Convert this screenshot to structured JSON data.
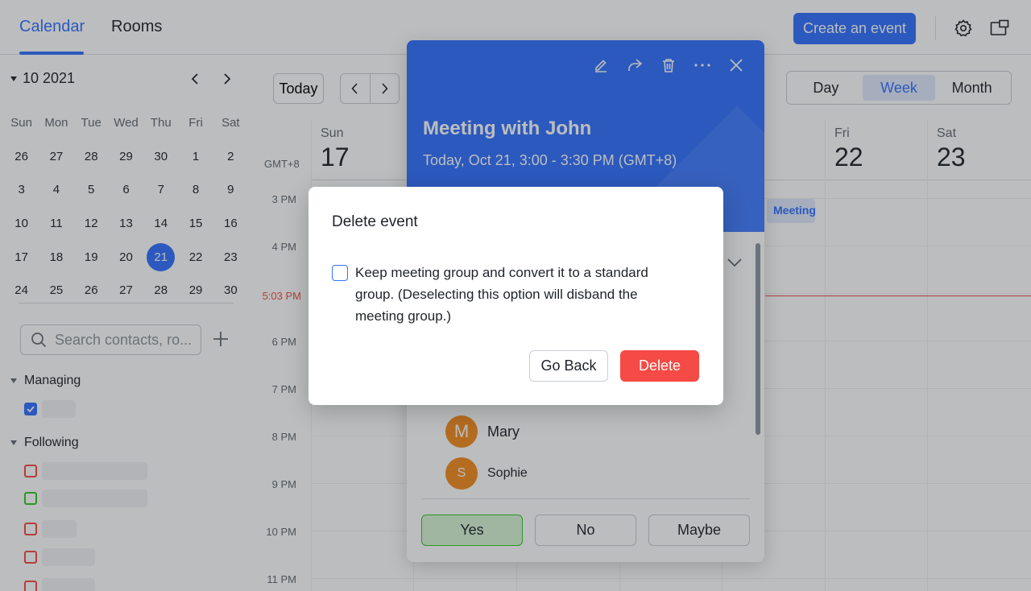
{
  "header": {
    "tabs": [
      {
        "label": "Calendar"
      },
      {
        "label": "Rooms"
      }
    ],
    "create_label": "Create an event"
  },
  "sidebar": {
    "month_label": "10 2021",
    "days_of_week": [
      "Sun",
      "Mon",
      "Tue",
      "Wed",
      "Thu",
      "Fri",
      "Sat"
    ],
    "weeks": [
      [
        "26",
        "27",
        "28",
        "29",
        "30",
        "1",
        "2"
      ],
      [
        "3",
        "4",
        "5",
        "6",
        "7",
        "8",
        "9"
      ],
      [
        "10",
        "11",
        "12",
        "13",
        "14",
        "15",
        "16"
      ],
      [
        "17",
        "18",
        "19",
        "20",
        "21",
        "22",
        "23"
      ],
      [
        "24",
        "25",
        "26",
        "27",
        "28",
        "29",
        "30"
      ]
    ],
    "selected_day": "21",
    "search_placeholder": "Search contacts, ro...",
    "managing_label": "Managing",
    "following_label": "Following"
  },
  "toolbar": {
    "today_label": "Today",
    "views": [
      {
        "label": "Day"
      },
      {
        "label": "Week",
        "active": true
      },
      {
        "label": "Month"
      }
    ]
  },
  "week": {
    "timezone": "GMT+8",
    "days": [
      {
        "name": "Sun",
        "date": "17"
      },
      {
        "name": "Fri",
        "date": "22"
      },
      {
        "name": "Sat",
        "date": "23"
      }
    ],
    "hours": [
      "3 PM",
      "4 PM",
      "5:03 PM",
      "6 PM",
      "7 PM",
      "8 PM",
      "9 PM",
      "10 PM",
      "11 PM"
    ],
    "mini_event_label": "Meeting"
  },
  "event": {
    "title": "Meeting with John",
    "time": "Today, Oct 21, 3:00 - 3:30 PM (GMT+8)",
    "attendees": [
      {
        "initial": "M",
        "name": "Mary"
      },
      {
        "initial": "S",
        "name": "Sophie"
      }
    ],
    "rsvp": [
      {
        "label": "Yes"
      },
      {
        "label": "No"
      },
      {
        "label": "Maybe"
      }
    ]
  },
  "dialog": {
    "title": "Delete event",
    "checkbox_text": "Keep meeting group and convert it to a standard group. (Deselecting this option will disband the meeting group.)",
    "go_back_label": "Go Back",
    "delete_label": "Delete"
  },
  "colors": {
    "primary": "#3370ff",
    "danger": "#f54a45",
    "accept_green": "#34c724",
    "avatar_orange": "#f58c1f"
  }
}
